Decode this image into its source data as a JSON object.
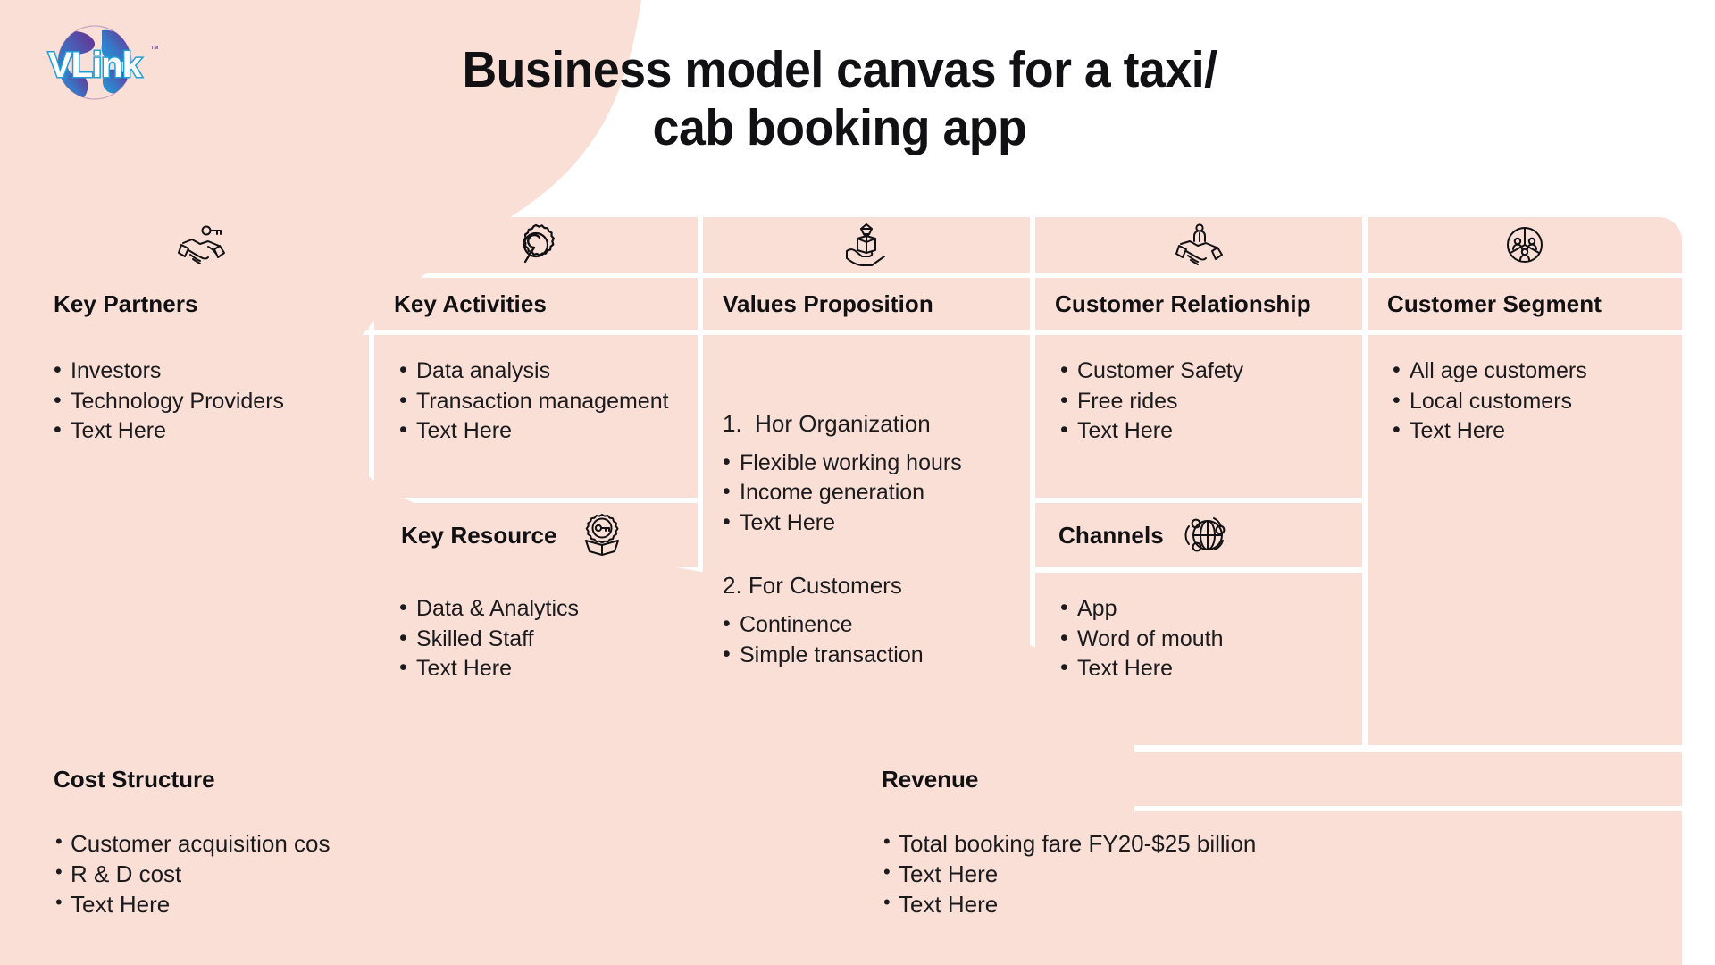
{
  "brand": {
    "logo_text": "VLink",
    "logo_tm": "™",
    "colors": {
      "page_bg": "#ffffff",
      "blob_pink": "#fadfd7",
      "cell_pink": "#fadfd7",
      "gutter_white": "#ffffff",
      "text_dark": "#111013",
      "logo_blue": "#2aa7df",
      "logo_purple": "#6b2d90"
    }
  },
  "header": {
    "title": "Business model canvas for a taxi/\ncab booking app",
    "title_line1": "Business model canvas for a taxi/",
    "title_line2": "cab booking app"
  },
  "canvas": {
    "columns": [
      {
        "id": "key-partners",
        "icon": "handshake-key-icon",
        "header": "Key Partners",
        "items": [
          "Investors",
          "Technology Providers",
          "Text Here"
        ]
      },
      {
        "id": "key-activities",
        "icon": "gear-wrench-icon",
        "header": "Key Activities",
        "items": [
          "Data analysis",
          "Transaction management",
          "Text Here"
        ],
        "sub": {
          "id": "key-resource",
          "header": "Key Resource",
          "icon": "key-in-box-icon",
          "items": [
            "Data & Analytics",
            "Skilled Staff",
            "Text Here"
          ]
        }
      },
      {
        "id": "values-proposition",
        "icon": "hand-diamond-icon",
        "header": "Values Proposition",
        "groups": [
          {
            "number": "1.",
            "title": "Hor Organization",
            "items": [
              "Flexible working hours",
              "Income generation",
              "Text Here"
            ]
          },
          {
            "number": "2.",
            "title": "For Customers",
            "items": [
              "Continence",
              "Simple transaction"
            ]
          }
        ]
      },
      {
        "id": "customer-relationship",
        "icon": "handshake-person-icon",
        "header": "Customer Relationship",
        "items": [
          "Customer Safety",
          "Free rides",
          "Text Here"
        ],
        "sub": {
          "id": "channels",
          "header": "Channels",
          "icon": "globe-network-icon",
          "items": [
            "App",
            "Word of mouth",
            "Text Here"
          ]
        }
      },
      {
        "id": "customer-segment",
        "icon": "people-circle-icon",
        "header": "Customer Segment",
        "items": [
          "All age customers",
          "Local customers",
          "Text Here"
        ]
      }
    ],
    "bottom": [
      {
        "id": "cost-structure",
        "header": "Cost Structure",
        "items": [
          "Customer acquisition cos",
          "R & D cost",
          "Text Here"
        ]
      },
      {
        "id": "revenue",
        "header": "Revenue",
        "items": [
          "Total booking fare FY20-$25 billion",
          "Text Here",
          "Text Here"
        ]
      }
    ]
  }
}
